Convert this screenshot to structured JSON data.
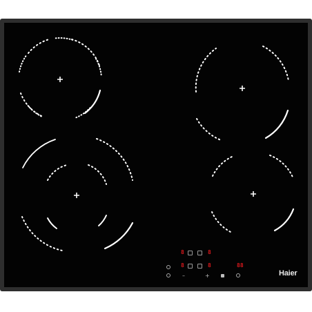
{
  "appliance": {
    "brand": "Haier",
    "zone_displays": [
      "8",
      "8",
      "8",
      "8"
    ],
    "timer_display": "88",
    "controls": {
      "minus": "–",
      "plus": "+"
    },
    "icons": [
      "power-icon",
      "info-icon",
      "lock-icon",
      "timer-icon"
    ],
    "colors": {
      "glass": "#030303",
      "frame": "#2e2e2e",
      "display": "#d8181c",
      "markings": "#ffffff"
    }
  }
}
